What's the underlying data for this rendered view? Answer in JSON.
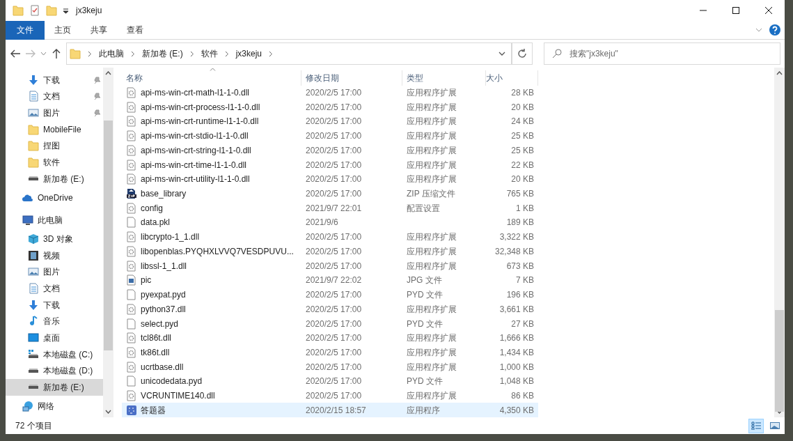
{
  "window": {
    "title": "jx3keju"
  },
  "ribbon_tabs": [
    {
      "label": "文件",
      "selected": true
    },
    {
      "label": "主页",
      "selected": false
    },
    {
      "label": "共享",
      "selected": false
    },
    {
      "label": "查看",
      "selected": false
    }
  ],
  "address": {
    "breadcrumbs": [
      "此电脑",
      "新加卷 (E:)",
      "软件",
      "jx3keju"
    ]
  },
  "search": {
    "placeholder": "搜索\"jx3keju\""
  },
  "navigation": {
    "pinned": [
      {
        "label": "下载",
        "kind": "download",
        "pinned": true
      },
      {
        "label": "文档",
        "kind": "document",
        "pinned": true
      },
      {
        "label": "图片",
        "kind": "pictures",
        "pinned": true
      },
      {
        "label": "MobileFile",
        "kind": "folder",
        "pinned": false
      },
      {
        "label": "捏图",
        "kind": "folder",
        "pinned": false
      },
      {
        "label": "软件",
        "kind": "folder",
        "pinned": false
      },
      {
        "label": "新加卷 (E:)",
        "kind": "drive",
        "pinned": false
      }
    ],
    "tree": [
      {
        "label": "OneDrive",
        "kind": "cloud",
        "selected": false
      },
      {
        "label": "此电脑",
        "kind": "computer",
        "selected": false,
        "children": [
          {
            "label": "3D 对象",
            "kind": "cube",
            "selected": false
          },
          {
            "label": "视频",
            "kind": "video",
            "selected": false
          },
          {
            "label": "图片",
            "kind": "pictures",
            "selected": false
          },
          {
            "label": "文档",
            "kind": "document",
            "selected": false
          },
          {
            "label": "下载",
            "kind": "download",
            "selected": false
          },
          {
            "label": "音乐",
            "kind": "music",
            "selected": false
          },
          {
            "label": "桌面",
            "kind": "desktop",
            "selected": false
          },
          {
            "label": "本地磁盘 (C:)",
            "kind": "system-drive",
            "selected": false
          },
          {
            "label": "本地磁盘 (D:)",
            "kind": "drive",
            "selected": false
          },
          {
            "label": "新加卷 (E:)",
            "kind": "drive",
            "selected": true
          }
        ]
      },
      {
        "label": "网络",
        "kind": "network",
        "selected": false
      }
    ]
  },
  "table": {
    "columns": [
      "名称",
      "修改日期",
      "类型",
      "大小"
    ],
    "rows": [
      {
        "kind": "dll",
        "name": "api-ms-win-crt-math-l1-1-0.dll",
        "date": "2020/2/5 17:00",
        "type": "应用程序扩展",
        "size": "28 KB",
        "selected": false
      },
      {
        "kind": "dll",
        "name": "api-ms-win-crt-process-l1-1-0.dll",
        "date": "2020/2/5 17:00",
        "type": "应用程序扩展",
        "size": "20 KB",
        "selected": false
      },
      {
        "kind": "dll",
        "name": "api-ms-win-crt-runtime-l1-1-0.dll",
        "date": "2020/2/5 17:00",
        "type": "应用程序扩展",
        "size": "24 KB",
        "selected": false
      },
      {
        "kind": "dll",
        "name": "api-ms-win-crt-stdio-l1-1-0.dll",
        "date": "2020/2/5 17:00",
        "type": "应用程序扩展",
        "size": "25 KB",
        "selected": false
      },
      {
        "kind": "dll",
        "name": "api-ms-win-crt-string-l1-1-0.dll",
        "date": "2020/2/5 17:00",
        "type": "应用程序扩展",
        "size": "25 KB",
        "selected": false
      },
      {
        "kind": "dll",
        "name": "api-ms-win-crt-time-l1-1-0.dll",
        "date": "2020/2/5 17:00",
        "type": "应用程序扩展",
        "size": "22 KB",
        "selected": false
      },
      {
        "kind": "dll",
        "name": "api-ms-win-crt-utility-l1-1-0.dll",
        "date": "2020/2/5 17:00",
        "type": "应用程序扩展",
        "size": "20 KB",
        "selected": false
      },
      {
        "kind": "zip",
        "name": "base_library",
        "date": "2020/2/5 17:00",
        "type": "ZIP 压缩文件",
        "size": "765 KB",
        "selected": false
      },
      {
        "kind": "dll",
        "name": "config",
        "date": "2021/9/7 22:01",
        "type": "配置设置",
        "size": "1 KB",
        "selected": false
      },
      {
        "kind": "blank",
        "name": "data.pkl",
        "date": "2021/9/6",
        "size": "189 KB",
        "selected": false
      },
      {
        "kind": "dll",
        "name": "libcrypto-1_1.dll",
        "date": "2020/2/5 17:00",
        "type": "应用程序扩展",
        "size": "3,322 KB",
        "selected": false
      },
      {
        "kind": "dll",
        "name": "libopenblas.PYQHXLVVQ7VESDPUVU...",
        "date": "2020/2/5 17:00",
        "type": "应用程序扩展",
        "size": "32,348 KB",
        "selected": false
      },
      {
        "kind": "dll",
        "name": "libssl-1_1.dll",
        "date": "2020/2/5 17:00",
        "type": "应用程序扩展",
        "size": "673 KB",
        "selected": false
      },
      {
        "kind": "image",
        "name": "pic",
        "date": "2021/9/7 22:02",
        "type": "JPG 文件",
        "size": "7 KB",
        "selected": false
      },
      {
        "kind": "blank",
        "name": "pyexpat.pyd",
        "date": "2020/2/5 17:00",
        "type": "PYD 文件",
        "size": "196 KB",
        "selected": false
      },
      {
        "kind": "dll",
        "name": "python37.dll",
        "date": "2020/2/5 17:00",
        "type": "应用程序扩展",
        "size": "3,661 KB",
        "selected": false
      },
      {
        "kind": "blank",
        "name": "select.pyd",
        "date": "2020/2/5 17:00",
        "type": "PYD 文件",
        "size": "27 KB",
        "selected": false
      },
      {
        "kind": "dll",
        "name": "tcl86t.dll",
        "date": "2020/2/5 17:00",
        "type": "应用程序扩展",
        "size": "1,666 KB",
        "selected": false
      },
      {
        "kind": "dll",
        "name": "tk86t.dll",
        "date": "2020/2/5 17:00",
        "type": "应用程序扩展",
        "size": "1,434 KB",
        "selected": false
      },
      {
        "kind": "dll",
        "name": "ucrtbase.dll",
        "date": "2020/2/5 17:00",
        "type": "应用程序扩展",
        "size": "1,000 KB",
        "selected": false
      },
      {
        "kind": "blank",
        "name": "unicodedata.pyd",
        "date": "2020/2/5 17:00",
        "type": "PYD 文件",
        "size": "1,048 KB",
        "selected": false
      },
      {
        "kind": "dll",
        "name": "VCRUNTIME140.dll",
        "date": "2020/2/5 17:00",
        "type": "应用程序扩展",
        "size": "86 KB",
        "selected": false
      },
      {
        "kind": "app",
        "name": "答题器",
        "date": "2020/2/15 18:57",
        "type": "应用程序",
        "size": "4,350 KB",
        "selected": true
      }
    ]
  },
  "status_bar": {
    "item_count": "72 个项目"
  }
}
